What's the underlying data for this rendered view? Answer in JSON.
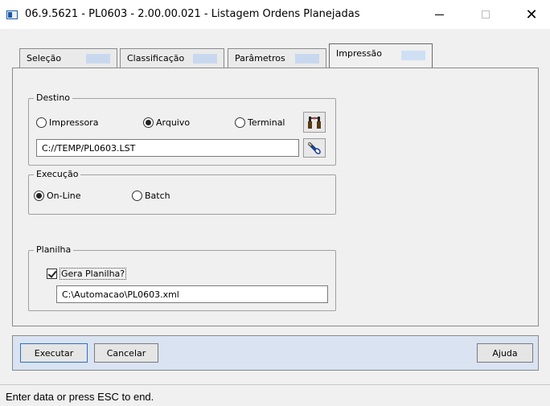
{
  "window": {
    "title": "06.9.5621 - PL0603 - 2.00.00.021 - Listagem Ordens Planejadas",
    "controls": {
      "minimize": "minimize",
      "maximize": "maximize",
      "close": "✕"
    }
  },
  "tabs": [
    {
      "label": "Seleção",
      "active": false
    },
    {
      "label": "Classificação",
      "active": false
    },
    {
      "label": "Parâmetros",
      "active": false
    },
    {
      "label": "Impressão",
      "active": true
    }
  ],
  "destino": {
    "legend": "Destino",
    "options": [
      {
        "label": "Impressora",
        "checked": false
      },
      {
        "label": "Arquivo",
        "checked": true
      },
      {
        "label": "Terminal",
        "checked": false
      }
    ],
    "path_value": "C://TEMP/PL0603.LST",
    "config_icon": "printer-setup-icon",
    "search_icon": "flashlight-search-icon"
  },
  "execucao": {
    "legend": "Execução",
    "options": [
      {
        "label": "On-Line",
        "checked": true
      },
      {
        "label": "Batch",
        "checked": false
      }
    ]
  },
  "planilha": {
    "legend": "Planilha",
    "checkbox_label": "Gera Planilha?",
    "checked": true,
    "file_value": "C:\\Automacao\\PL0603.xml"
  },
  "buttons": {
    "executar": "Executar",
    "cancelar": "Cancelar",
    "ajuda": "Ajuda"
  },
  "status": {
    "text": "Enter data or press ESC to end."
  }
}
